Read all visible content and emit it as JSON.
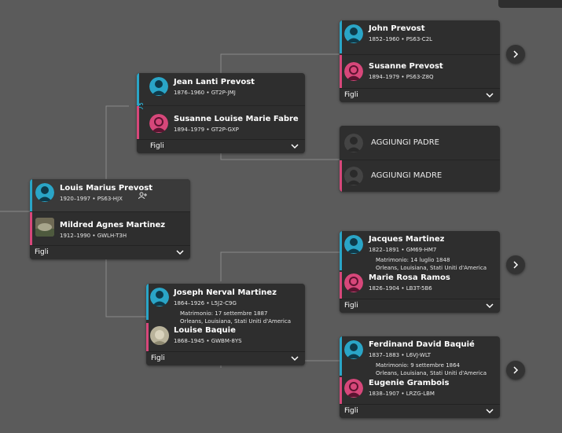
{
  "tree": {
    "focus": {
      "father": {
        "name": "Louis Marius Prevost",
        "meta": "1920–1997 • PS63-HJX"
      },
      "mother": {
        "name": "Mildred Agnes Martinez",
        "meta": "1912–1990 • GWLH-T3H"
      },
      "children_label": "Figli"
    },
    "paternal": {
      "father": {
        "name": "Jean Lanti Prevost",
        "meta": "1876–1960 • GT2P-JMJ"
      },
      "mother": {
        "name": "Susanne Louise Marie Fabre",
        "meta": "1894–1979 • GT2P-GXP"
      },
      "children_label": "Figli"
    },
    "maternal": {
      "father": {
        "name": "Joseph Nerval Martinez",
        "meta": "1864–1926 • L5J2-C9G"
      },
      "marriage": "Matrimonio: 17 settembre 1887",
      "place": "Orleans, Louisiana, Stati Uniti d'America",
      "mother": {
        "name": "Louise Baquie",
        "meta": "1868–1945 • GWBM-8YS"
      },
      "children_label": "Figli"
    },
    "gp1": {
      "father": {
        "name": "John Prevost",
        "meta": "1852–1960 • PS63-C2L"
      },
      "mother": {
        "name": "Susanne Prevost",
        "meta": "1894–1979 • PS63-Z8Q"
      },
      "children_label": "Figli"
    },
    "gp2": {
      "add_father": "AGGIUNGI PADRE",
      "add_mother": "AGGIUNGI MADRE"
    },
    "gp3": {
      "father": {
        "name": "Jacques Martinez",
        "meta": "1822–1891 • GM69-HM7"
      },
      "marriage": "Matrimonio: 14 luglio 1848",
      "place": "Orleans, Louisiana, Stati Uniti d'America",
      "mother": {
        "name": "Marie Rosa Ramos",
        "meta": "1826–1904 • LB3T-5B6"
      },
      "children_label": "Figli"
    },
    "gp4": {
      "father": {
        "name": "Ferdinand David Baquié",
        "meta": "1837–1883 • L6VJ-WLT"
      },
      "marriage": "Matrimonio: 9 settembre 1864",
      "place": "Orleans, Louisiana, Stati Uniti d'America",
      "mother": {
        "name": "Eugenie Grambois",
        "meta": "1838–1907 • LRZG-LBM"
      },
      "children_label": "Figli"
    }
  },
  "colors": {
    "background": "#5b5b5b",
    "card": "#2e2e2e",
    "male": "#2aa5c7",
    "female": "#d7477a"
  },
  "icons": [
    "male-avatar-icon",
    "female-avatar-icon",
    "empty-avatar-icon",
    "photo-avatar-icon",
    "chevron-down-icon",
    "chevron-right-icon",
    "couple-swap-icon",
    "person-settings-icon"
  ]
}
